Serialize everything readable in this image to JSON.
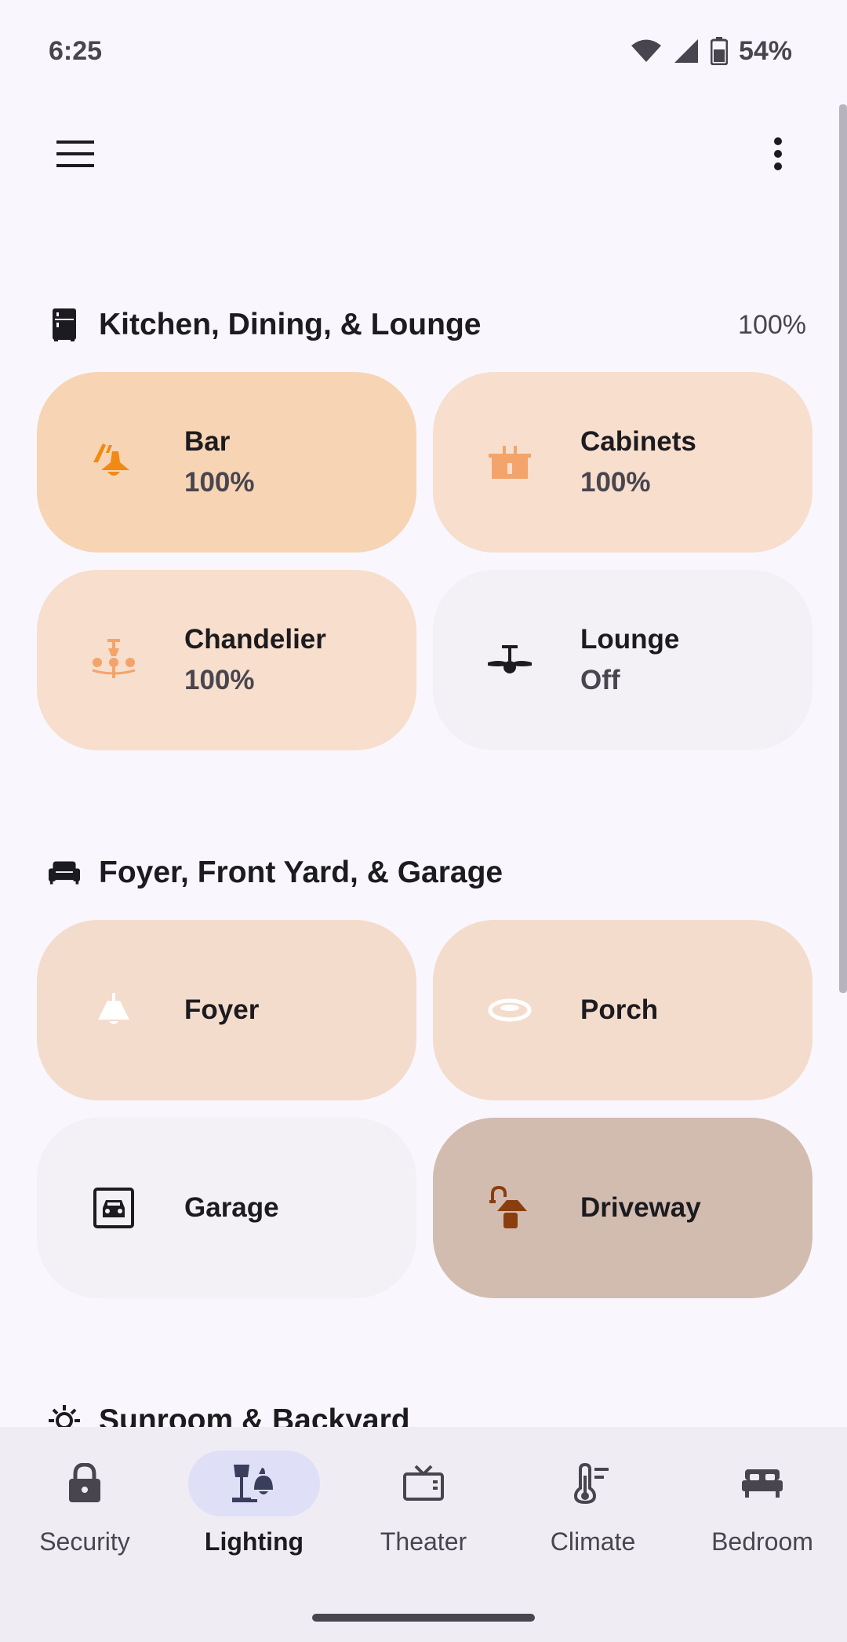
{
  "status_bar": {
    "time": "6:25",
    "battery": "54%"
  },
  "sections": [
    {
      "title": "Kitchen, Dining, & Lounge",
      "value": "100%",
      "icon": "fridge-icon",
      "tiles": [
        {
          "name": "Bar",
          "state": "100%",
          "icon": "pendant-lamp-icon",
          "icon_color": "#f08a14",
          "bg": "#f7d4b4"
        },
        {
          "name": "Cabinets",
          "state": "100%",
          "icon": "cabinet-light-icon",
          "icon_color": "#f3a46a",
          "bg": "#f7decd"
        },
        {
          "name": "Chandelier",
          "state": "100%",
          "icon": "chandelier-icon",
          "icon_color": "#f3a46a",
          "bg": "#f7decd"
        },
        {
          "name": "Lounge",
          "state": "Off",
          "icon": "ceiling-fan-icon",
          "icon_color": "#1c1b1f",
          "bg": "#f3f1f6"
        }
      ]
    },
    {
      "title": "Foyer, Front Yard, & Garage",
      "icon": "sofa-icon",
      "tiles": [
        {
          "name": "Foyer",
          "icon": "foyer-lamp-icon",
          "icon_color": "#ffffff",
          "bg": "#f4dccd"
        },
        {
          "name": "Porch",
          "icon": "ceiling-light-icon",
          "icon_color": "#ffffff",
          "bg": "#f4dccd"
        },
        {
          "name": "Garage",
          "icon": "garage-icon",
          "icon_color": "#1c1b1f",
          "bg": "#f3f1f6"
        },
        {
          "name": "Driveway",
          "icon": "outdoor-lamp-icon",
          "icon_color": "#8a3e10",
          "bg": "#d2bcb0"
        }
      ]
    },
    {
      "title": "Sunroom & Backyard",
      "icon": "sun-icon"
    }
  ],
  "bottom_nav": [
    {
      "label": "Security",
      "icon": "lock-icon",
      "active": false
    },
    {
      "label": "Lighting",
      "icon": "lamp-icon",
      "active": true
    },
    {
      "label": "Theater",
      "icon": "tv-icon",
      "active": false
    },
    {
      "label": "Climate",
      "icon": "thermometer-icon",
      "active": false
    },
    {
      "label": "Bedroom",
      "icon": "bed-icon",
      "active": false
    }
  ]
}
